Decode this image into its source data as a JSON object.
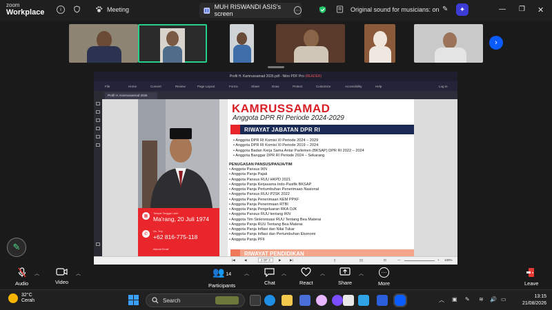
{
  "app": {
    "brand_top": "zoom",
    "brand_bottom": "Workplace"
  },
  "topbar": {
    "meeting_label": "Meeting",
    "share_name": "MUH RISWANDI ASIS's screen",
    "audio_label": "Original sound for musicians: on"
  },
  "document": {
    "app_title": "Profil H. Kamrussamad 2026.pdf - Nitro PDF Pro",
    "app_title_suffix": "(READER)",
    "menu": [
      "File",
      "Home",
      "Convert",
      "Review",
      "Page Layout",
      "Forms",
      "Share",
      "Draw",
      "Protect",
      "Customize",
      "Accessibility",
      "Help"
    ],
    "login": "Log In",
    "tab_name": "Profil H. Kamrussamad 2026",
    "page_indicator": "1 OF 2",
    "zoom": "100%",
    "name": "KAMRUSSAMAD",
    "subtitle": "Anggota DPR RI Periode 2024-2029",
    "section1": "RIWAYAT JABATAN DPR RI",
    "section1_items": [
      "Anggota DPR RI Komisi XI Periode 2024 – 2029",
      "Anggota DPR RI Komisi XI Periode 2019 – 2024",
      "Anggota Badan Kerja Sama Antar Parlemen (BKSAP) DPR RI 2022 – 2024",
      "Anggota Banggar DPR RI Periode 2024 – Sekarang"
    ],
    "section2": "PENUGASAN PANSUS/PANJA/TIM",
    "section2_items": [
      "Anggota Pansus IKN",
      "Anggota Panja Pajak",
      "Anggota Pansus RUU HKPD 2021",
      "Anggota Panja Kerjasama Indo-Pasifik BKSAP",
      "Anggota Panja Pertumbuhan Penerimaan Nasional",
      "Anggota Pansus RUU P2SK 2022",
      "Anggota Panja Penerimaan KEM PPKF",
      "Anggota Panja Penerimaan RTBI",
      "Anggota Panja Pengeluaran RKA OJK",
      "Anggota Pansus RUU tentang IKN",
      "Anggota Tim Sinkronisasi RUU Tentang Bea Materai",
      "Anggota Panja RUU Tentang Bea Materai",
      "Anggota Panja Inflasi dan Nilai Tukar",
      "Anggota Panja Inflasi dan Pertumbuhan Ekonomi",
      "Anggota Panja PFII"
    ],
    "section3": "RIWAYAT PENDIDIKAN",
    "birth_label": "Tempat Tanggal Lahir",
    "birth_value": "Ma'rang, 20 Juli 1974",
    "phone_label": "No. Telp",
    "phone_value": "+62 816-775-118",
    "addr_label": "Alamat Email"
  },
  "toolbar": {
    "audio": "Audio",
    "video": "Video",
    "participants": "Participants",
    "participants_count": "14",
    "chat": "Chat",
    "react": "React",
    "share": "Share",
    "more": "More",
    "leave": "Leave"
  },
  "taskbar": {
    "temp": "32°C",
    "weather": "Cerah",
    "search_placeholder": "Search",
    "time": "13:15",
    "date": "21/08/2026"
  },
  "colors": {
    "accent_green": "#23d18b",
    "zoom_blue": "#0b5cff",
    "doc_red": "#e8262c",
    "doc_navy": "#1b2a55"
  }
}
